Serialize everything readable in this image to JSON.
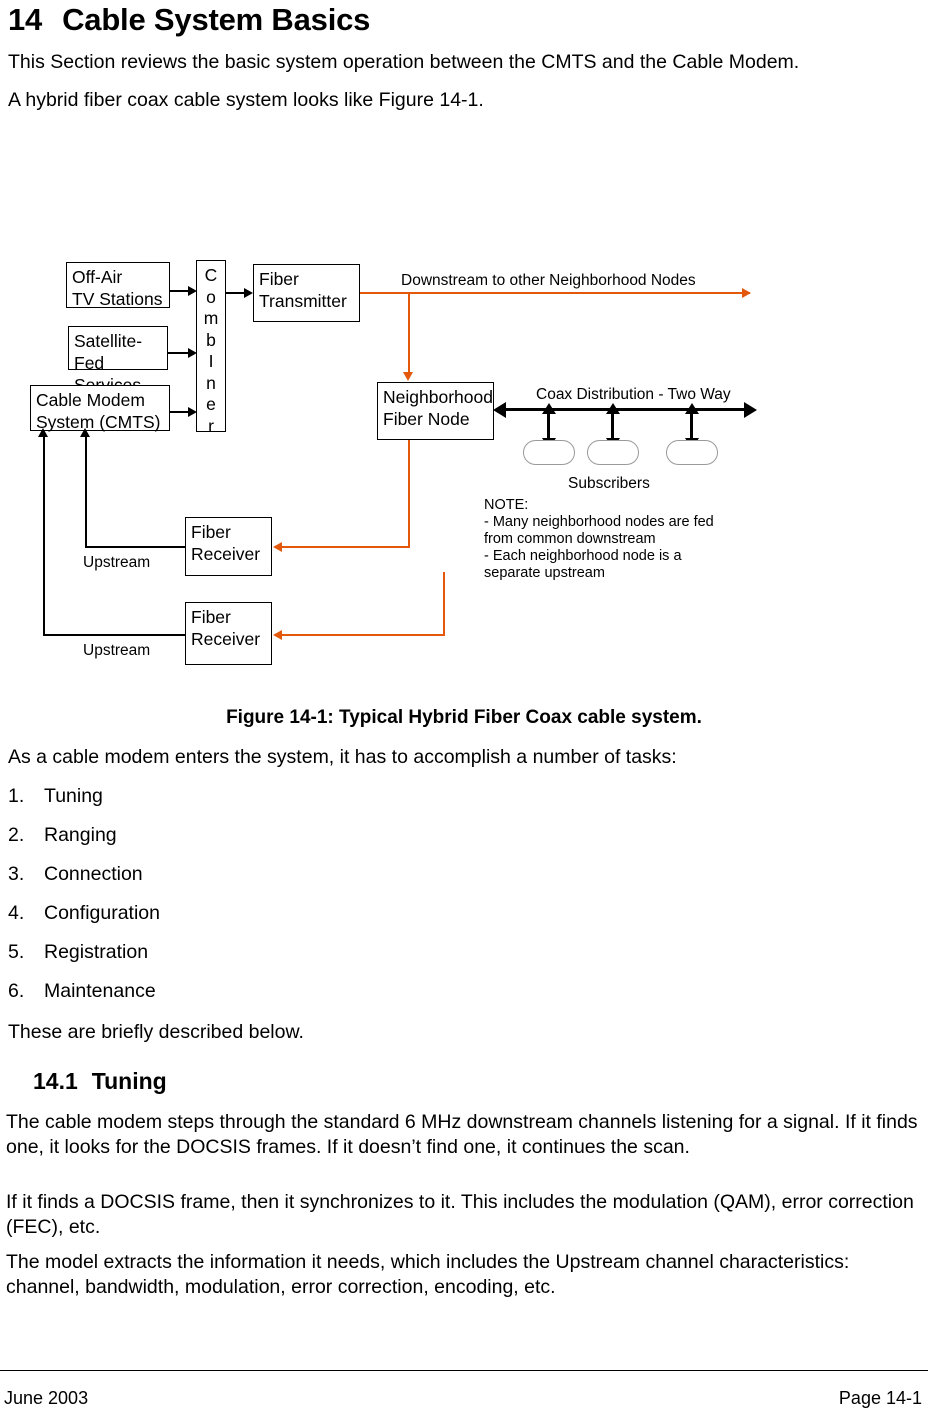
{
  "document": {
    "chapter_number": "14",
    "chapter_title": "Cable System Basics",
    "intro_paragraph_1": "This Section reviews the basic system operation between the CMTS and the Cable Modem.",
    "intro_paragraph_2": "A hybrid fiber coax cable system looks like Figure 14-1.",
    "figure_caption": "Figure 14-1: Typical Hybrid Fiber Coax cable system.",
    "tasks_lead_in": "As a cable modem enters the system, it has to accomplish a number of tasks:",
    "tasks": [
      {
        "number": "1.",
        "label": "Tuning"
      },
      {
        "number": "2.",
        "label": "Ranging"
      },
      {
        "number": "3.",
        "label": "Connection"
      },
      {
        "number": "4.",
        "label": "Configuration"
      },
      {
        "number": "5.",
        "label": "Registration"
      },
      {
        "number": "6.",
        "label": "Maintenance"
      }
    ],
    "tasks_closing": "These are briefly described below.",
    "section_number": "14.1",
    "section_title": "Tuning",
    "body_paragraph_1": "The cable modem steps through the standard 6 MHz downstream channels listening for a signal.  If it finds one, it looks for the DOCSIS frames.  If it doesn’t find one, it continues the scan.",
    "body_paragraph_2": "If it finds a DOCSIS frame, then it synchronizes to it.  This includes the modulation (QAM), error correction (FEC), etc.",
    "body_paragraph_3": "The model extracts the information it needs, which includes the Upstream channel characteristics: channel, bandwidth, modulation, error correction, encoding, etc."
  },
  "footer": {
    "date": "June 2003",
    "page": "Page 14-1"
  },
  "figure": {
    "boxes": {
      "off_air": "Off-Air\nTV Stations",
      "satellite": "Satellite-Fed\nServices",
      "cmts": "Cable Modem\nSystem (CMTS)",
      "combiner": "C\no\nm\nb\nI\nn\ne\nr",
      "fiber_transmitter": "Fiber\nTransmitter",
      "neighborhood_node": "Neighborhood\nFiber Node",
      "fiber_receiver_1": "Fiber\nReceiver",
      "fiber_receiver_2": "Fiber\nReceiver"
    },
    "labels": {
      "downstream": "Downstream to other Neighborhood Nodes",
      "coax": "Coax Distribution - Two Way",
      "subscribers": "Subscribers",
      "upstream_1": "Upstream",
      "upstream_2": "Upstream",
      "note": "NOTE:\n- Many neighborhood nodes are fed\nfrom common downstream\n- Each neighborhood node is a\nseparate upstream"
    },
    "colors": {
      "fiber_link": "#e4580c",
      "coax_link": "#000000",
      "subscriber_outline": "#9a9a9a"
    }
  }
}
